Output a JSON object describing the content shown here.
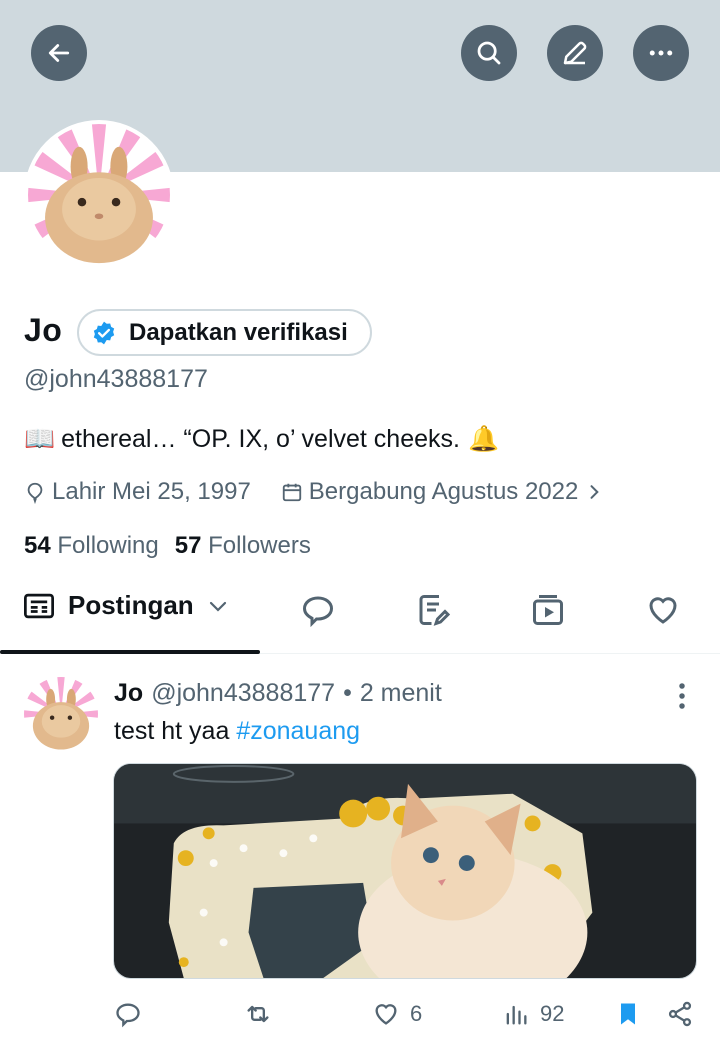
{
  "colors": {
    "banner": "#cfd9de",
    "button_bg": "#536471",
    "verified_blue": "#1d9bf0",
    "bookmark_blue": "#1d9bf0",
    "text_muted": "#536471"
  },
  "header": {
    "back_icon": "arrow-left-icon",
    "search_icon": "search-icon",
    "edit_icon": "pencil-icon",
    "more_icon": "more-horizontal-icon"
  },
  "profile": {
    "name": "Jo",
    "verify_label": "Dapatkan verifikasi",
    "handle": "@john43888177",
    "bio_text": "ethereal… “OP. IX, o’ velvet cheeks.",
    "bio_emoji_start": "📖",
    "bio_emoji_end": "🔔",
    "birth_label": "Lahir Mei 25, 1997",
    "joined_label": "Bergabung Agustus 2022",
    "following_count": "54",
    "following_label": "Following",
    "followers_count": "57",
    "followers_label": "Followers"
  },
  "tabs": {
    "active_label": "Postingan",
    "icons": [
      "reply-bubble-icon",
      "article-edit-icon",
      "media-play-icon",
      "heart-icon"
    ]
  },
  "post": {
    "name": "Jo",
    "handle": "@john43888177",
    "separator": "•",
    "time": "2 menit",
    "text": "test ht yaa",
    "hashtag": "#zonauang",
    "likes": "6",
    "views": "92"
  }
}
